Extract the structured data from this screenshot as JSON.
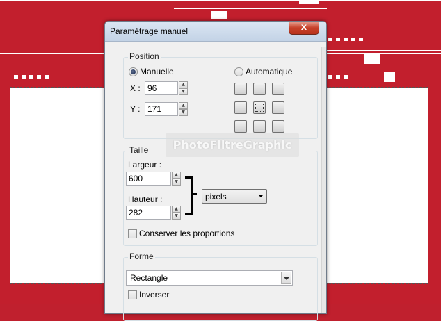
{
  "dialog": {
    "title": "Paramétrage manuel",
    "close_label": "x"
  },
  "position": {
    "group_label": "Position",
    "manual_label": "Manuelle",
    "auto_label": "Automatique",
    "x_label": "X :",
    "x_value": "96",
    "y_label": "Y :",
    "y_value": "171",
    "selected_mode": "Manuelle"
  },
  "size": {
    "group_label": "Taille",
    "width_label": "Largeur :",
    "width_value": "600",
    "height_label": "Hauteur :",
    "height_value": "282",
    "unit_value": "pixels",
    "keep_ratio_label": "Conserver les proportions",
    "keep_ratio_checked": false
  },
  "shape": {
    "group_label": "Forme",
    "shape_value": "Rectangle",
    "invert_label": "Inverser",
    "invert_checked": false
  },
  "watermark": "PhotoFiltreGraphic",
  "colors": {
    "background_red": "#c21f2d",
    "dialog_bg": "#f0f0f0",
    "close_red": "#c7412a"
  }
}
